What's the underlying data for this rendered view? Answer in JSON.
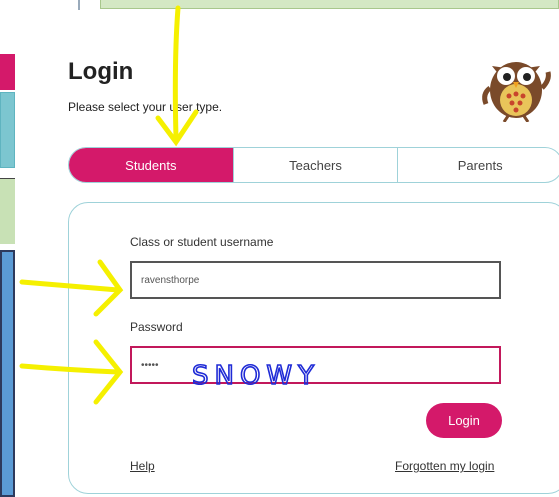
{
  "login": {
    "title": "Login",
    "subtitle": "Please select your user type."
  },
  "user_types": [
    {
      "label": "Students",
      "active": true
    },
    {
      "label": "Teachers",
      "active": false
    },
    {
      "label": "Parents",
      "active": false
    }
  ],
  "form": {
    "username_label": "Class or student username",
    "username_value": "ravensthorpe",
    "password_label": "Password",
    "password_value": "•••••",
    "login_label": "Login",
    "help_label": "Help",
    "forgot_label": "Forgotten my login"
  },
  "annotations": {
    "handwritten_text": "SNOWY",
    "arrow_color": "#f5f000",
    "handwriting_color": "#1f2bd6"
  },
  "colors": {
    "accent": "#d4196a",
    "border": "#9fd2d9"
  },
  "icons": [
    "owl-mascot-icon",
    "arrow-down-icon",
    "arrow-right-icon"
  ]
}
